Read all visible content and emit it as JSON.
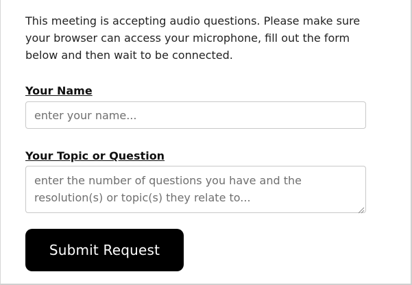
{
  "intro": {
    "text": "This meeting is accepting audio questions. Please make sure your browser can access your microphone, fill out the form below and then wait to be connected."
  },
  "form": {
    "name": {
      "label": "Your Name",
      "value": "",
      "placeholder": "enter your name..."
    },
    "topic": {
      "label": "Your Topic or Question",
      "value": "",
      "placeholder": "enter the number of questions you have and the resolution(s) or topic(s) they relate to..."
    },
    "submit_label": "Submit Request"
  },
  "colors": {
    "button_bg": "#000000",
    "button_text": "#ffffff",
    "input_border": "#c8c8c8",
    "placeholder": "#6f6f6f"
  },
  "icons": {
    "resize": "textarea-resize-grip-icon"
  }
}
